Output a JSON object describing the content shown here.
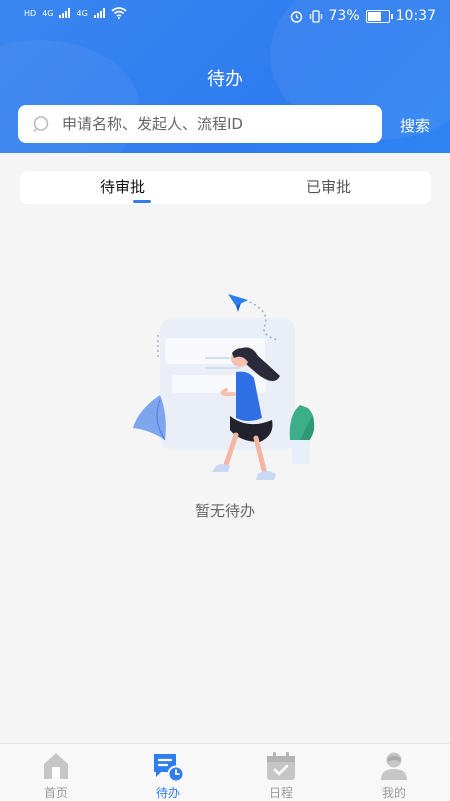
{
  "status_bar": {
    "network_left": "HD",
    "signal_tag": "4G",
    "battery_percent": "73%",
    "battery_level": 0.73,
    "time": "10:37"
  },
  "header": {
    "title": "待办",
    "search_placeholder": "申请名称、发起人、流程ID",
    "search_button": "搜索",
    "accent_color": "#2f7ef0"
  },
  "tabs": [
    {
      "label": "待审批",
      "active": true
    },
    {
      "label": "已审批",
      "active": false
    }
  ],
  "empty_state": {
    "message": "暂无待办",
    "illustration": "person-walking-with-paper-plane"
  },
  "bottom_nav": [
    {
      "label": "首页",
      "icon": "home-icon",
      "active": false
    },
    {
      "label": "待办",
      "icon": "todo-icon",
      "active": true
    },
    {
      "label": "日程",
      "icon": "calendar-icon",
      "active": false
    },
    {
      "label": "我的",
      "icon": "profile-icon",
      "active": false
    }
  ]
}
